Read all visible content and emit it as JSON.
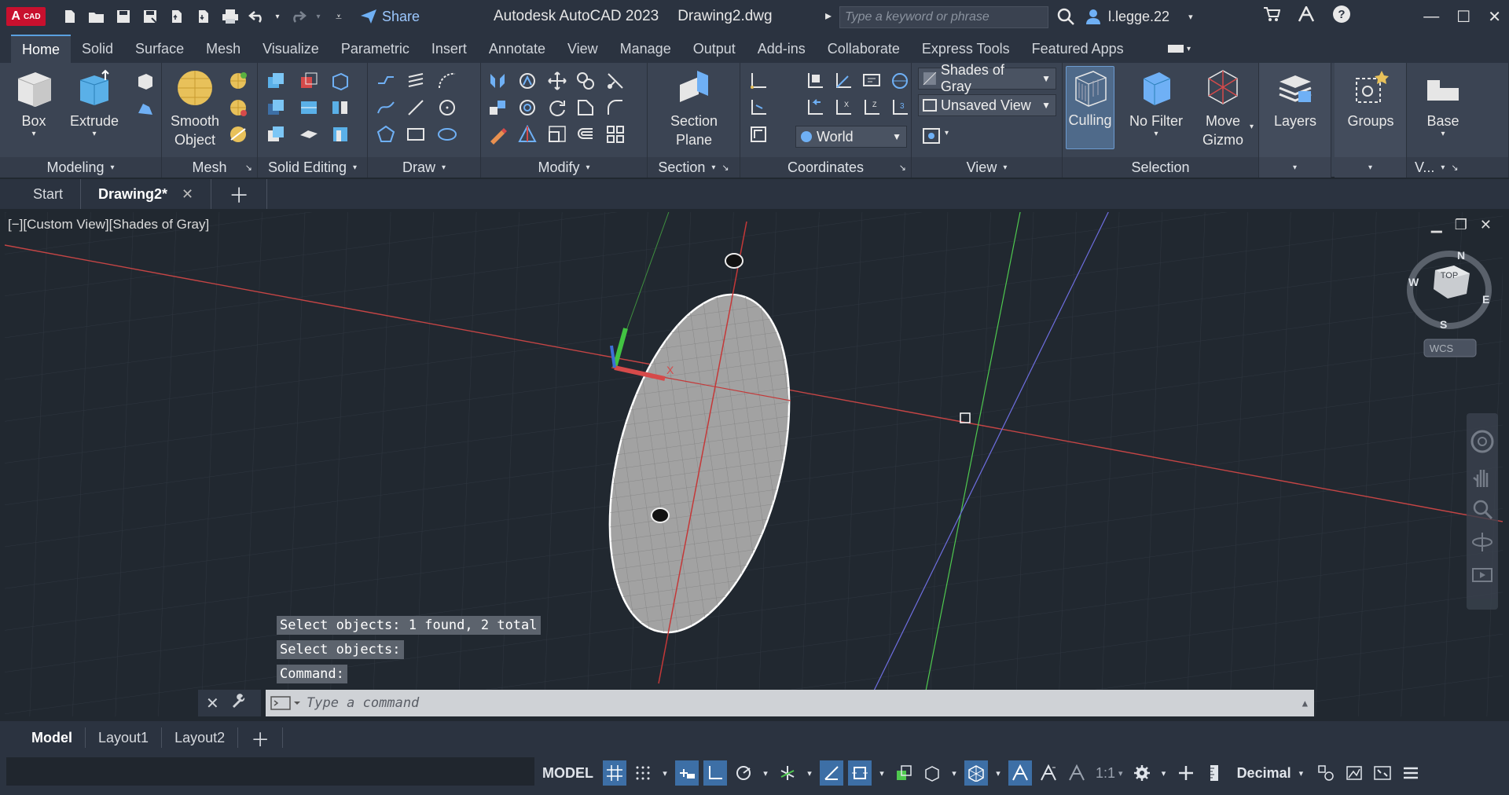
{
  "app": {
    "logo_text": "A",
    "logo_sub": "CAD",
    "title": "Autodesk AutoCAD 2023",
    "drawing": "Drawing2.dwg",
    "share_label": "Share",
    "search_placeholder": "Type a keyword or phrase",
    "user": "l.legge.22"
  },
  "ribbon_tabs": [
    "Home",
    "Solid",
    "Surface",
    "Mesh",
    "Visualize",
    "Parametric",
    "Insert",
    "Annotate",
    "View",
    "Manage",
    "Output",
    "Add-ins",
    "Collaborate",
    "Express Tools",
    "Featured Apps"
  ],
  "panels": {
    "modeling": "Modeling",
    "mesh": "Mesh",
    "solid_editing": "Solid Editing",
    "draw": "Draw",
    "modify": "Modify",
    "section": "Section",
    "coordinates": "Coordinates",
    "view": "View",
    "selection": "Selection",
    "v": "V..."
  },
  "buttons": {
    "box": "Box",
    "extrude": "Extrude",
    "smooth_object_1": "Smooth",
    "smooth_object_2": "Object",
    "section_plane_1": "Section",
    "section_plane_2": "Plane",
    "culling": "Culling",
    "no_filter": "No Filter",
    "move_gizmo_1": "Move",
    "move_gizmo_2": "Gizmo",
    "layers": "Layers",
    "groups": "Groups",
    "base": "Base"
  },
  "dropdowns": {
    "visual_style": "Shades of Gray",
    "named_view": "Unsaved View",
    "ucs": "World"
  },
  "file_tabs": {
    "start": "Start",
    "drawing": "Drawing2*"
  },
  "viewport": {
    "label": "[−][Custom View][Shades of Gray]",
    "viewcube": {
      "top": "TOP",
      "n": "N",
      "s": "S",
      "e": "E",
      "w": "W",
      "wcs": "WCS"
    }
  },
  "command": {
    "history": [
      "Select objects: 1 found, 2 total",
      "Select objects:",
      "Command:"
    ],
    "placeholder": "Type a command"
  },
  "layout_tabs": [
    "Model",
    "Layout1",
    "Layout2"
  ],
  "status": {
    "model": "MODEL",
    "scale": "1:1",
    "units": "Decimal"
  },
  "colors": {
    "accent": "#3d6fa6",
    "viewport_bg": "#212830",
    "ribbon_bg": "#3b4453",
    "x_axis": "#d64a4a",
    "y_axis": "#47c447",
    "z_axis": "#6a6ae0"
  }
}
